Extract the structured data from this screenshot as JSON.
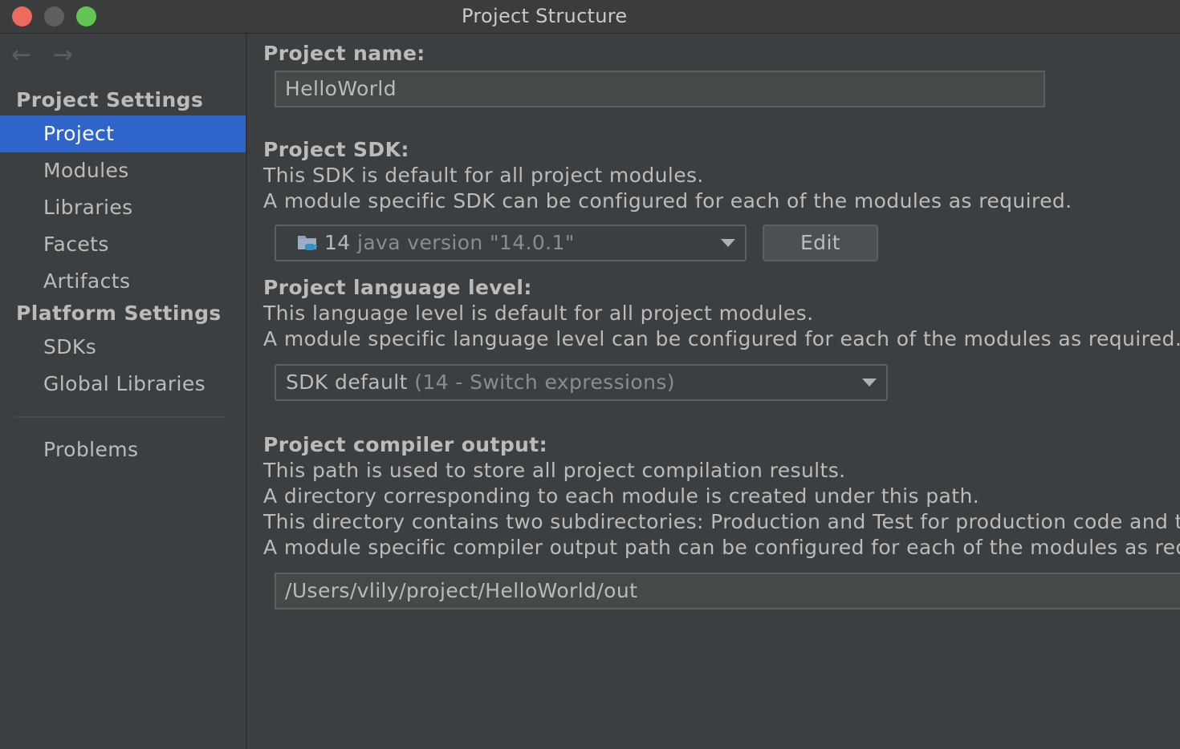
{
  "window": {
    "title": "Project Structure"
  },
  "sidebar": {
    "back_arrow": "←",
    "forward_arrow": "→",
    "project_settings_header": "Project Settings",
    "project_settings_items": [
      {
        "label": "Project",
        "selected": true
      },
      {
        "label": "Modules"
      },
      {
        "label": "Libraries"
      },
      {
        "label": "Facets"
      },
      {
        "label": "Artifacts"
      }
    ],
    "platform_settings_header": "Platform Settings",
    "platform_settings_items": [
      {
        "label": "SDKs"
      },
      {
        "label": "Global Libraries"
      }
    ],
    "problems_label": "Problems"
  },
  "main": {
    "project_name": {
      "label": "Project name:",
      "value": "HelloWorld"
    },
    "project_sdk": {
      "label": "Project SDK:",
      "desc_line1": "This SDK is default for all project modules.",
      "desc_line2": "A module specific SDK can be configured for each of the modules as required.",
      "selected_value": "14",
      "selected_hint": "java version \"14.0.1\"",
      "icon": "folder-java-icon",
      "edit_label": "Edit"
    },
    "language_level": {
      "label": "Project language level:",
      "desc_line1": "This language level is default for all project modules.",
      "desc_line2": "A module specific language level can be configured for each of the modules as required.",
      "selected_value": "SDK default",
      "selected_hint": "(14 - Switch expressions)"
    },
    "compiler_output": {
      "label": "Project compiler output:",
      "desc_line1": "This path is used to store all project compilation results.",
      "desc_line2": "A directory corresponding to each module is created under this path.",
      "desc_line3": "This directory contains two subdirectories: Production and Test for production code and t",
      "desc_line4": "A module specific compiler output path can be configured for each of the modules as requ",
      "value": "/Users/vlily/project/HelloWorld/out"
    }
  },
  "colors": {
    "background": "#3c3f41",
    "selection": "#2f65ca",
    "text": "#bbbbbb",
    "hint_text": "#8a8d8f"
  }
}
